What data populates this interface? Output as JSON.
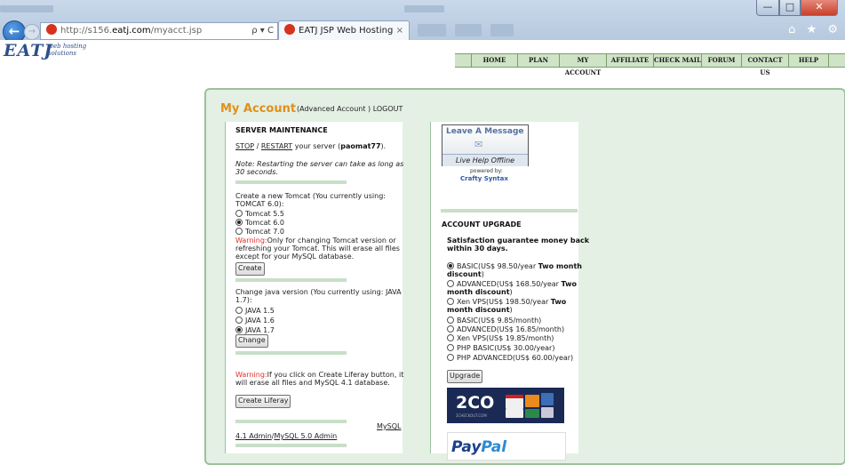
{
  "browser": {
    "url_prefix": "http://s156.",
    "url_domain": "eatj.com",
    "url_path": "/myacct.jsp",
    "address_tools": "ρ ▾ C",
    "tab_title": "EATJ JSP Web Hosting",
    "tab_close": "×",
    "back_glyph": "←",
    "forward_glyph": "→",
    "right_icons": "⌂ ★ ⚙",
    "win_min": "—",
    "win_max": "□",
    "win_close": "✕"
  },
  "site": {
    "logo": "EATJ",
    "logo_sub_line1": "web hosting",
    "logo_sub_line2": "solutions",
    "menu": [
      "HOME",
      "PLAN",
      "MY ACCOUNT",
      "AFFILIATE",
      "CHECK MAIL",
      "FORUM",
      "CONTACT US",
      "HELP"
    ]
  },
  "account": {
    "title": "My Account",
    "type_text": "(Advanced Account )",
    "logout": "LOGOUT"
  },
  "server": {
    "heading": "SERVER MAINTENANCE",
    "stop": "STOP",
    "slash": " / ",
    "restart": "RESTART",
    "your_server": " your server (",
    "username": "paomat77",
    "end": ").",
    "note": "Note: Restarting the server can take as long as 30 seconds."
  },
  "tomcat": {
    "intro": "Create a new Tomcat (You currently using: TOMCAT 6.0):",
    "options": [
      "Tomcat 5.5",
      "Tomcat 6.0",
      "Tomcat 7.0"
    ],
    "warning_label": "Warning:",
    "warning_text": "Only for changing Tomcat version or refreshing your Tomcat. This will erase all files except for your MySQL database.",
    "button": "Create"
  },
  "java": {
    "intro": "Change java version (You currently using: JAVA 1.7):",
    "options": [
      "JAVA 1.5",
      "JAVA 1.6",
      "JAVA 1.7"
    ],
    "button": "Change"
  },
  "liferay": {
    "warning_label": "Warning:",
    "warning_text": "If you click on Create Liferay button, it will erase all files and MySQL 4.1 database.",
    "button": "Create Liferay"
  },
  "mysql": {
    "link1_a": "MySQL",
    "link1_b": "4.1 Admin",
    "slash": "/",
    "link2": "MySQL 5.0 Admin"
  },
  "livehelp": {
    "title": "Leave A Message",
    "envelope": "✉",
    "status": "Live Help Offline",
    "powered": "powered by:",
    "brand": "Crafty Syntax"
  },
  "upgrade": {
    "heading": "ACCOUNT UPGRADE",
    "guarantee": "Satisfaction guarantee money back within 30 days.",
    "plans": [
      {
        "pre": "BASIC(US$ 98.50/year ",
        "bold": "Two month discount",
        "post": ")"
      },
      {
        "pre": "ADVANCED(US$ 168.50/year ",
        "bold": "Two month discount",
        "post": ")"
      },
      {
        "pre": "Xen VPS(US$ 198.50/year ",
        "bold": "Two month discount",
        "post": ")"
      },
      {
        "pre": "BASIC(US$ 9.85/month)",
        "bold": "",
        "post": ""
      },
      {
        "pre": "ADVANCED(US$ 16.85/month)",
        "bold": "",
        "post": ""
      },
      {
        "pre": "Xen VPS(US$ 19.85/month)",
        "bold": "",
        "post": ""
      },
      {
        "pre": "PHP BASIC(US$ 30.00/year)",
        "bold": "",
        "post": ""
      },
      {
        "pre": "PHP ADVANCED(US$ 60.00/year)",
        "bold": "",
        "post": ""
      }
    ],
    "button": "Upgrade"
  },
  "payment": {
    "twoco": "2CO",
    "twoco_sub": "2CHECKOUT.COM",
    "paypal_a": "Pay",
    "paypal_b": "Pal"
  },
  "colors": {
    "accent_orange": "#e0901c",
    "warning_red": "#e0302a",
    "panel_green": "#e4f0e4",
    "menu_green": "#cfe3c6"
  }
}
